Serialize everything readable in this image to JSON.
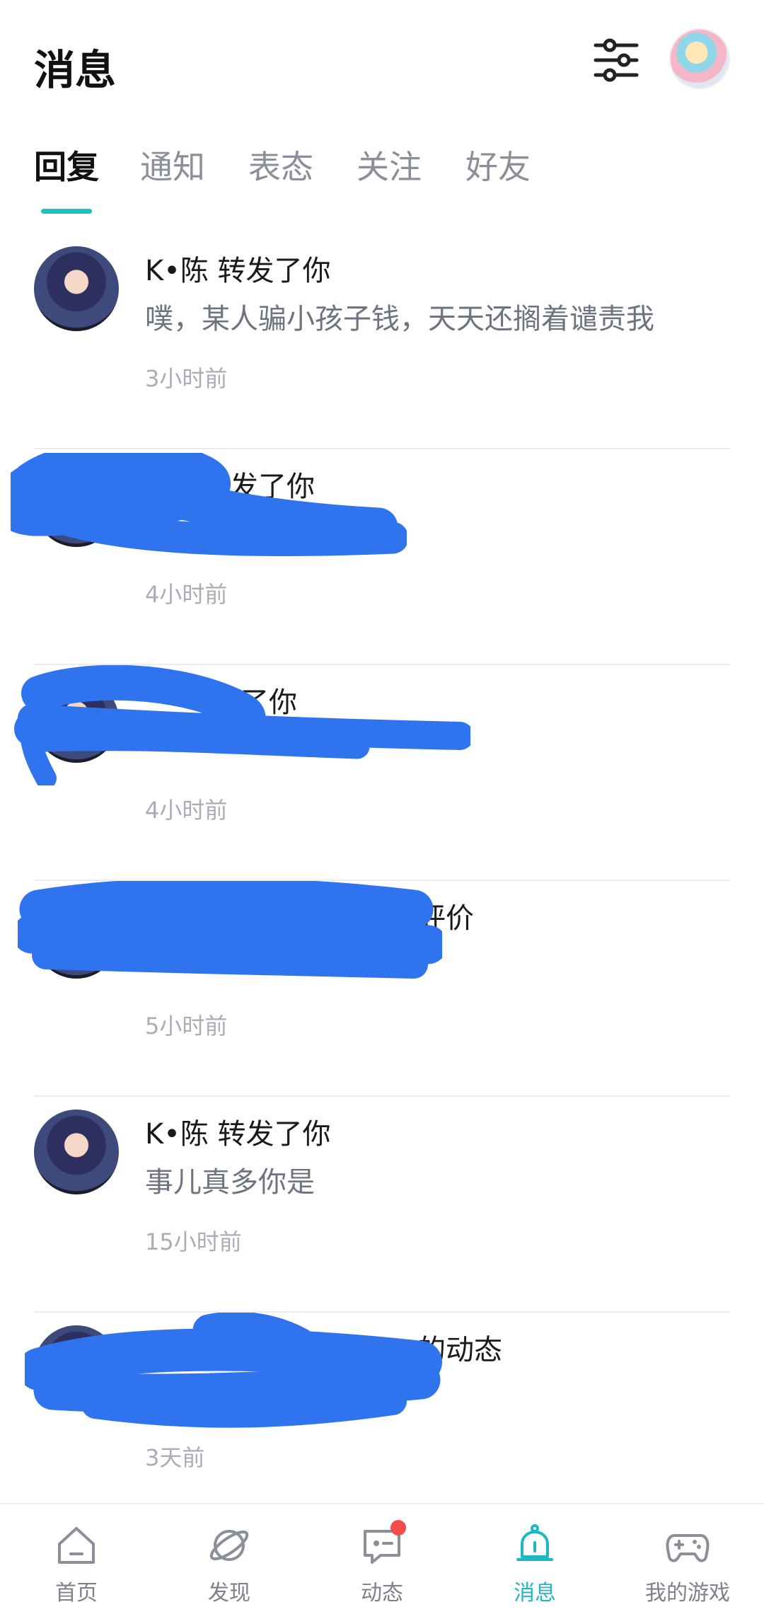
{
  "header": {
    "title": "消息"
  },
  "tabs": [
    {
      "label": "回复",
      "active": true
    },
    {
      "label": "通知",
      "active": false
    },
    {
      "label": "表态",
      "active": false
    },
    {
      "label": "关注",
      "active": false
    },
    {
      "label": "好友",
      "active": false
    }
  ],
  "messages": [
    {
      "title": "K•陈 转发了你",
      "preview": "噗，某人骗小孩子钱，天天还搁着谴责我",
      "time": "3小时前",
      "redacted": false
    },
    {
      "title": "转发了你",
      "preview": "",
      "time": "4小时前",
      "redacted": true
    },
    {
      "title": "发了你",
      "preview": "",
      "time": "4小时前",
      "redacted": true
    },
    {
      "title": "的评价",
      "preview": "",
      "time": "5小时前",
      "redacted": true
    },
    {
      "title": "K•陈 转发了你",
      "preview": "事儿真多你是",
      "time": "15小时前",
      "redacted": false
    },
    {
      "title": "的动态",
      "preview": "",
      "time": "3天前",
      "redacted": true
    }
  ],
  "bottom_nav": [
    {
      "label": "首页",
      "icon": "home-icon",
      "active": false
    },
    {
      "label": "发现",
      "icon": "planet-icon",
      "active": false
    },
    {
      "label": "动态",
      "icon": "chat-icon",
      "active": false,
      "badge": true
    },
    {
      "label": "消息",
      "icon": "bell-icon",
      "active": true
    },
    {
      "label": "我的游戏",
      "icon": "gamepad-icon",
      "active": false
    }
  ],
  "colors": {
    "accent": "#1fc1c8",
    "badge": "#f24b4b",
    "scribble": "#2f73ee"
  }
}
